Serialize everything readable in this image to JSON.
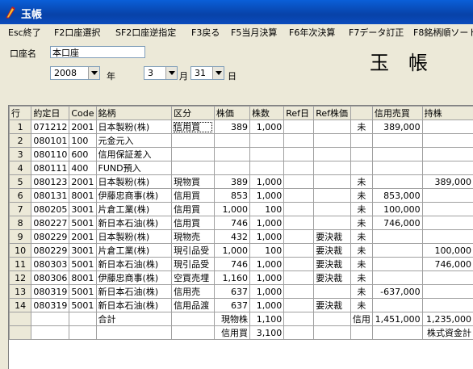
{
  "window": {
    "title": "玉帳"
  },
  "menu": [
    "Esc終了",
    "F2口座選択",
    "SF2口座逆指定",
    "F3戻る",
    "F5当月決算",
    "F6年次決算",
    "F7データ訂正",
    "F8銘柄順ソート"
  ],
  "form": {
    "account_label": "口座名",
    "account_value": "本口座",
    "year_value": "2008",
    "year_unit": "年",
    "month_value": "3",
    "month_unit": "月",
    "day_value": "31",
    "day_unit": "日",
    "book_title": "玉帳"
  },
  "table": {
    "headers": [
      "行",
      "約定日",
      "Code",
      "銘柄",
      "区分",
      "株価",
      "株数",
      "Ref日",
      "Ref株価",
      "",
      "信用売買",
      "持株"
    ],
    "rows": [
      [
        "1",
        "071212",
        "2001",
        "日本製粉(株)",
        "信用買",
        "389",
        "1,000",
        "",
        "",
        "未",
        "389,000",
        ""
      ],
      [
        "2",
        "080101",
        "100",
        "元金元入",
        "",
        "",
        "",
        "",
        "",
        "",
        "",
        ""
      ],
      [
        "3",
        "080110",
        "600",
        "信用保証差入",
        "",
        "",
        "",
        "",
        "",
        "",
        "",
        ""
      ],
      [
        "4",
        "080111",
        "400",
        "FUND預入",
        "",
        "",
        "",
        "",
        "",
        "",
        "",
        ""
      ],
      [
        "5",
        "080123",
        "2001",
        "日本製粉(株)",
        "現物買",
        "389",
        "1,000",
        "",
        "",
        "未",
        "",
        "389,000"
      ],
      [
        "6",
        "080131",
        "8001",
        "伊藤忠商事(株)",
        "信用買",
        "853",
        "1,000",
        "",
        "",
        "未",
        "853,000",
        ""
      ],
      [
        "7",
        "080205",
        "3001",
        "片倉工業(株)",
        "信用買",
        "1,000",
        "100",
        "",
        "",
        "未",
        "100,000",
        ""
      ],
      [
        "8",
        "080227",
        "5001",
        "新日本石油(株)",
        "信用買",
        "746",
        "1,000",
        "",
        "",
        "未",
        "746,000",
        ""
      ],
      [
        "9",
        "080229",
        "2001",
        "日本製粉(株)",
        "現物売",
        "432",
        "1,000",
        "",
        "要決裁",
        "未",
        "",
        ""
      ],
      [
        "10",
        "080229",
        "3001",
        "片倉工業(株)",
        "現引品受",
        "1,000",
        "100",
        "",
        "要決裁",
        "未",
        "",
        "100,000"
      ],
      [
        "11",
        "080303",
        "5001",
        "新日本石油(株)",
        "現引品受",
        "746",
        "1,000",
        "",
        "要決裁",
        "未",
        "",
        "746,000"
      ],
      [
        "12",
        "080306",
        "8001",
        "伊藤忠商事(株)",
        "空買売埋",
        "1,160",
        "1,000",
        "",
        "要決裁",
        "未",
        "",
        ""
      ],
      [
        "13",
        "080319",
        "5001",
        "新日本石油(株)",
        "信用売",
        "637",
        "1,000",
        "",
        "",
        "未",
        "-637,000",
        ""
      ],
      [
        "14",
        "080319",
        "5001",
        "新日本石油(株)",
        "信用品渡",
        "637",
        "1,000",
        "",
        "要決裁",
        "未",
        "",
        ""
      ],
      [
        "",
        "",
        "",
        "合計",
        "",
        "現物株",
        "1,100",
        "",
        "",
        "信用",
        "1,451,000",
        "1,235,000"
      ],
      [
        "",
        "",
        "",
        "",
        "",
        "信用買",
        "3,100",
        "",
        "",
        "",
        "",
        "株式資金計"
      ]
    ]
  }
}
